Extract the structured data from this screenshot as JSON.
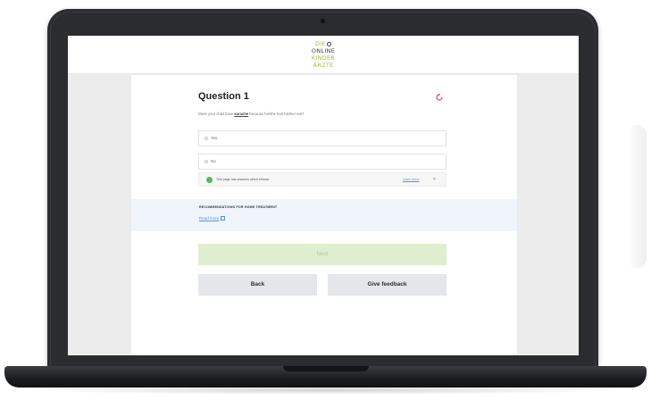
{
  "header": {
    "logo": {
      "line1": "DIE",
      "line2": "ONLINE",
      "line3": "KINDER",
      "line4": "ÄRZTE"
    }
  },
  "question": {
    "title": "Question 1",
    "text_before": "Does your child have ",
    "text_emphasis": "earache",
    "text_after": " because he/she hurt his/her ear?"
  },
  "options": [
    {
      "label": "Yes"
    },
    {
      "label": "No"
    }
  ],
  "info_bar": {
    "text": "This page has answers which follows.",
    "link": "Learn more",
    "close": "×"
  },
  "recommendations": {
    "title": "RECOMMENDATIONS FOR HOME TREATMENT",
    "link": "Read more"
  },
  "buttons": {
    "next": "Next",
    "back": "Back",
    "feedback": "Give feedback"
  },
  "colors": {
    "accent_green": "#9fbf3b",
    "next_bg": "#dfeecf",
    "reset_red": "#e8423a",
    "link_blue": "#5b8fd6"
  }
}
